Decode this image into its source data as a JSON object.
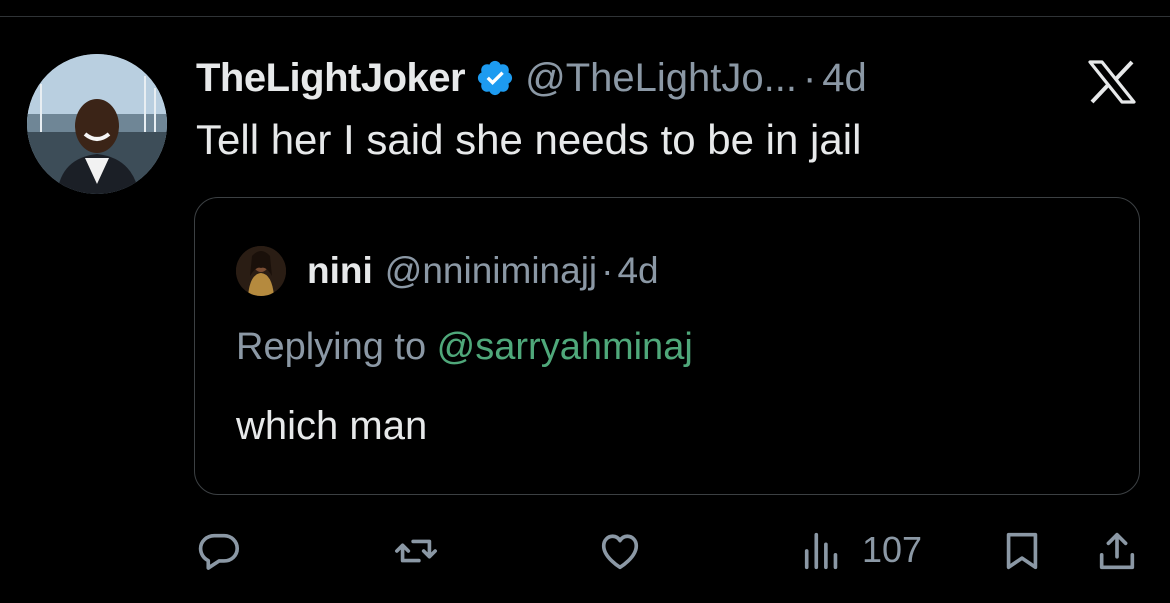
{
  "tweet": {
    "display_name": "TheLightJoker",
    "handle": "@TheLightJo...",
    "separator": "·",
    "time": "4d",
    "text": "Tell her I said she needs to be in jail",
    "verified": true
  },
  "quoted_tweet": {
    "display_name": "nini",
    "handle": "@nniniminajj",
    "separator": "·",
    "time": "4d",
    "replying_prefix": "Replying to ",
    "replying_mention": "@sarryahminaj",
    "text": "which man"
  },
  "actions": {
    "views": "107",
    "icons": [
      "reply-icon",
      "retweet-icon",
      "like-icon",
      "views-icon",
      "bookmark-icon",
      "share-icon"
    ]
  },
  "colors": {
    "background": "#000000",
    "primary_text": "#e7e9ea",
    "secondary_text": "#8b98a5",
    "verified_badge": "#1d9bf0",
    "mention": "#4fa87a",
    "border": "#3c4043"
  }
}
